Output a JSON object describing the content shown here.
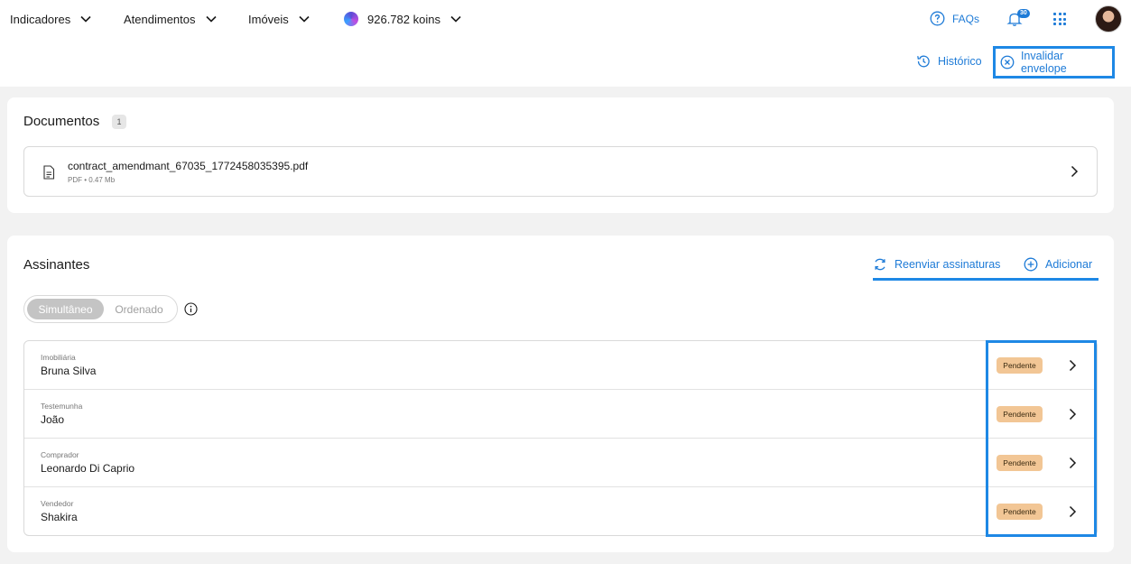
{
  "nav": {
    "items": [
      {
        "label": "Indicadores"
      },
      {
        "label": "Atendimentos"
      },
      {
        "label": "Imóveis"
      }
    ],
    "koins": "926.782 koins",
    "faq": "FAQs",
    "notifications_count": "30"
  },
  "header_actions": {
    "historico": "Histórico",
    "invalidar": "Invalidar envelope"
  },
  "documents": {
    "title": "Documentos",
    "count": "1",
    "items": [
      {
        "name": "contract_amendmant_67035_1772458035395.pdf",
        "meta": "PDF • 0.47 Mb"
      }
    ]
  },
  "signers": {
    "title": "Assinantes",
    "resend": "Reenviar assinaturas",
    "add": "Adicionar",
    "mode": {
      "active": "Simultâneo",
      "inactive": "Ordenado"
    },
    "rows": [
      {
        "role": "Imobiliária",
        "name": "Bruna Silva",
        "status": "Pendente"
      },
      {
        "role": "Testemunha",
        "name": "João",
        "status": "Pendente"
      },
      {
        "role": "Comprador",
        "name": "Leonardo Di Caprio",
        "status": "Pendente"
      },
      {
        "role": "Vendedor",
        "name": "Shakira",
        "status": "Pendente"
      }
    ]
  },
  "colors": {
    "accent": "#1e7bd7",
    "highlight": "#1e88e5",
    "pending_badge": "#f2c695"
  }
}
